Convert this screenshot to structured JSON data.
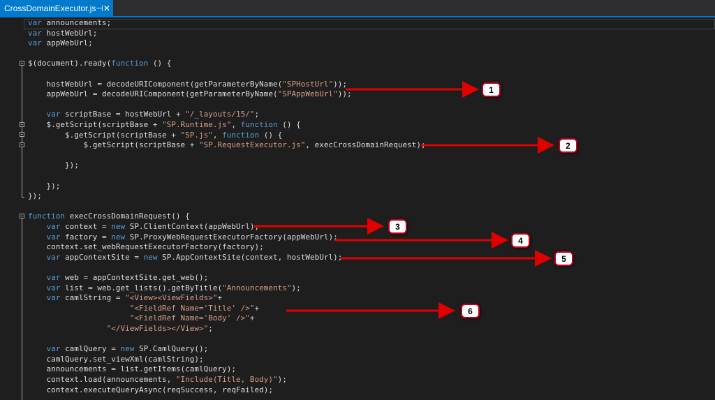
{
  "tab": {
    "title": "CrossDomainExecutor.js",
    "pin_glyph": "⊣",
    "close_glyph": "✕"
  },
  "theme": {
    "keyword": "#569cd6",
    "string": "#d69d85",
    "text": "#dcdcdc",
    "accent": "#007acc",
    "callout_border": "#c0001a",
    "arrow": "#e00000"
  },
  "code": [
    [
      [
        "kw",
        "var"
      ],
      [
        "t",
        " announcements;"
      ]
    ],
    [
      [
        "kw",
        "var"
      ],
      [
        "t",
        " hostWebUrl;"
      ]
    ],
    [
      [
        "kw",
        "var"
      ],
      [
        "t",
        " appWebUrl;"
      ]
    ],
    [],
    [
      [
        "t",
        "$(document).ready("
      ],
      [
        "kw",
        "function"
      ],
      [
        "t",
        " () {"
      ]
    ],
    [],
    [
      [
        "t",
        "    hostWebUrl = decodeURIComponent(getParameterByName("
      ],
      [
        "s",
        "\"SPHostUrl\""
      ],
      [
        "t",
        "));"
      ]
    ],
    [
      [
        "t",
        "    appWebUrl = decodeURIComponent(getParameterByName("
      ],
      [
        "s",
        "\"SPAppWebUrl\""
      ],
      [
        "t",
        "));"
      ]
    ],
    [],
    [
      [
        "t",
        "    "
      ],
      [
        "kw",
        "var"
      ],
      [
        "t",
        " scriptBase = hostWebUrl + "
      ],
      [
        "s",
        "\"/_layouts/15/\""
      ],
      [
        "t",
        ";"
      ]
    ],
    [
      [
        "t",
        "    $.getScript(scriptBase + "
      ],
      [
        "s",
        "\"SP.Runtime.js\""
      ],
      [
        "t",
        ", "
      ],
      [
        "kw",
        "function"
      ],
      [
        "t",
        " () {"
      ]
    ],
    [
      [
        "t",
        "        $.getScript(scriptBase + "
      ],
      [
        "s",
        "\"SP.js\""
      ],
      [
        "t",
        ", "
      ],
      [
        "kw",
        "function"
      ],
      [
        "t",
        " () {"
      ]
    ],
    [
      [
        "t",
        "            $.getScript(scriptBase + "
      ],
      [
        "s",
        "\"SP.RequestExecutor.js\""
      ],
      [
        "t",
        ", execCrossDomainRequest);"
      ]
    ],
    [],
    [
      [
        "t",
        "        });"
      ]
    ],
    [],
    [
      [
        "t",
        "    });"
      ]
    ],
    [
      [
        "t",
        "});"
      ]
    ],
    [],
    [
      [
        "kw",
        "function"
      ],
      [
        "t",
        " execCrossDomainRequest() {"
      ]
    ],
    [
      [
        "t",
        "    "
      ],
      [
        "kw",
        "var"
      ],
      [
        "t",
        " context = "
      ],
      [
        "kw",
        "new"
      ],
      [
        "t",
        " SP.ClientContext(appWebUrl);"
      ]
    ],
    [
      [
        "t",
        "    "
      ],
      [
        "kw",
        "var"
      ],
      [
        "t",
        " factory = "
      ],
      [
        "kw",
        "new"
      ],
      [
        "t",
        " SP.ProxyWebRequestExecutorFactory(appWebUrl);"
      ]
    ],
    [
      [
        "t",
        "    context.set_webRequestExecutorFactory(factory);"
      ]
    ],
    [
      [
        "t",
        "    "
      ],
      [
        "kw",
        "var"
      ],
      [
        "t",
        " appContextSite = "
      ],
      [
        "kw",
        "new"
      ],
      [
        "t",
        " SP.AppContextSite(context, hostWebUrl);"
      ]
    ],
    [],
    [
      [
        "t",
        "    "
      ],
      [
        "kw",
        "var"
      ],
      [
        "t",
        " web = appContextSite.get_web();"
      ]
    ],
    [
      [
        "t",
        "    "
      ],
      [
        "kw",
        "var"
      ],
      [
        "t",
        " list = web.get_lists().getByTitle("
      ],
      [
        "s",
        "\"Announcements\""
      ],
      [
        "t",
        ");"
      ]
    ],
    [
      [
        "t",
        "    "
      ],
      [
        "kw",
        "var"
      ],
      [
        "t",
        " camlString = "
      ],
      [
        "s",
        "\"<View><ViewFields>\""
      ],
      [
        "t",
        "+"
      ]
    ],
    [
      [
        "t",
        "                      "
      ],
      [
        "s",
        "\"<FieldRef Name='Title' />\""
      ],
      [
        "t",
        "+"
      ]
    ],
    [
      [
        "t",
        "                      "
      ],
      [
        "s",
        "\"<FieldRef Name='Body' />\""
      ],
      [
        "t",
        "+"
      ]
    ],
    [
      [
        "t",
        "                 "
      ],
      [
        "s",
        "\"</ViewFields></View>\""
      ],
      [
        "t",
        ";"
      ]
    ],
    [],
    [
      [
        "t",
        "    "
      ],
      [
        "kw",
        "var"
      ],
      [
        "t",
        " camlQuery = "
      ],
      [
        "kw",
        "new"
      ],
      [
        "t",
        " SP.CamlQuery();"
      ]
    ],
    [
      [
        "t",
        "    camlQuery.set_viewXml(camlString);"
      ]
    ],
    [
      [
        "t",
        "    announcements = list.getItems(camlQuery);"
      ]
    ],
    [
      [
        "t",
        "    context.load(announcements, "
      ],
      [
        "s",
        "\"Include(Title, Body)\""
      ],
      [
        "t",
        ");"
      ]
    ],
    [
      [
        "t",
        "    context.executeQueryAsync(reqSuccess, reqFailed);"
      ]
    ]
  ],
  "callouts": [
    "1",
    "2",
    "3",
    "4",
    "5",
    "6"
  ]
}
